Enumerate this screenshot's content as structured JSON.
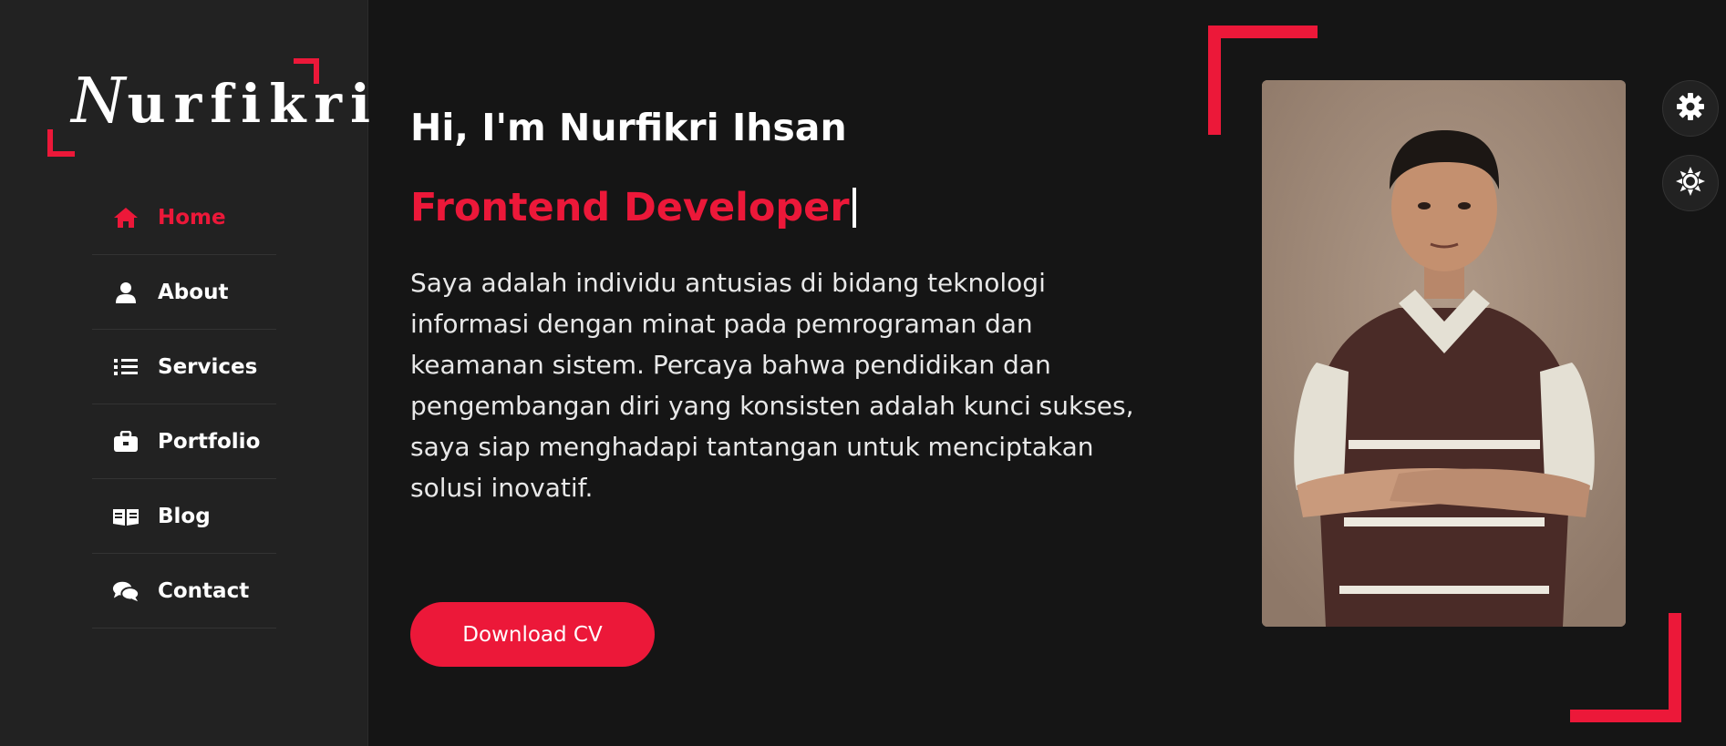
{
  "logo": {
    "text": "Nurfikri"
  },
  "nav": {
    "items": [
      {
        "label": "Home",
        "icon": "home-icon",
        "active": true
      },
      {
        "label": "About",
        "icon": "user-icon",
        "active": false
      },
      {
        "label": "Services",
        "icon": "list-icon",
        "active": false
      },
      {
        "label": "Portfolio",
        "icon": "briefcase-icon",
        "active": false
      },
      {
        "label": "Blog",
        "icon": "book-icon",
        "active": false
      },
      {
        "label": "Contact",
        "icon": "comments-icon",
        "active": false
      }
    ]
  },
  "hero": {
    "greeting": "Hi, I'm Nurfikri Ihsan",
    "role": "Frontend Developer",
    "description": "Saya adalah individu antusias di bidang teknologi informasi dengan minat pada pemrograman dan keamanan sistem. Percaya bahwa pendidikan dan pengembangan diri yang konsisten adalah kunci sukses, saya siap menghadapi tantangan untuk menciptakan solusi inovatif.",
    "cta_label": "Download CV"
  },
  "controls": {
    "settings_icon": "gear-icon",
    "theme_icon": "sun-icon"
  },
  "colors": {
    "accent": "#ec1839",
    "background": "#151515",
    "sidebar": "#222222"
  }
}
